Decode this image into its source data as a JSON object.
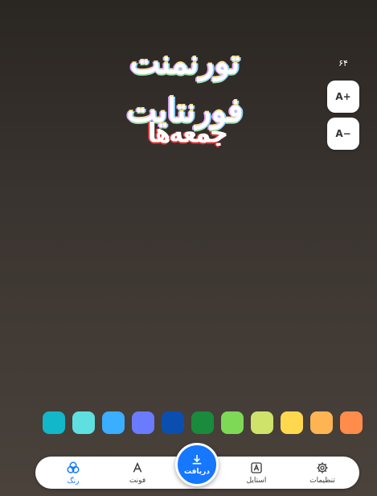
{
  "canvas": {
    "title_text": "تورنمنت فورنتایت",
    "subtitle_text": "جمعه‌ها"
  },
  "font_size": {
    "value": "۶۴",
    "increase_label": "A+",
    "decrease_label": "A−"
  },
  "swatches": [
    "#ff8c4a",
    "#ffb454",
    "#ffd84d",
    "#cfe36a",
    "#7ed957",
    "#1a8a3c",
    "#0a4fb0",
    "#6b7bff",
    "#3aaeff",
    "#5ee0e0",
    "#12b7c9"
  ],
  "bottom_nav": {
    "settings_label": "تنظیمات",
    "style_label": "استایل",
    "download_label": "دریافت",
    "font_label": "فونت",
    "color_label": "رنگ",
    "active_color": "#1677ff"
  }
}
